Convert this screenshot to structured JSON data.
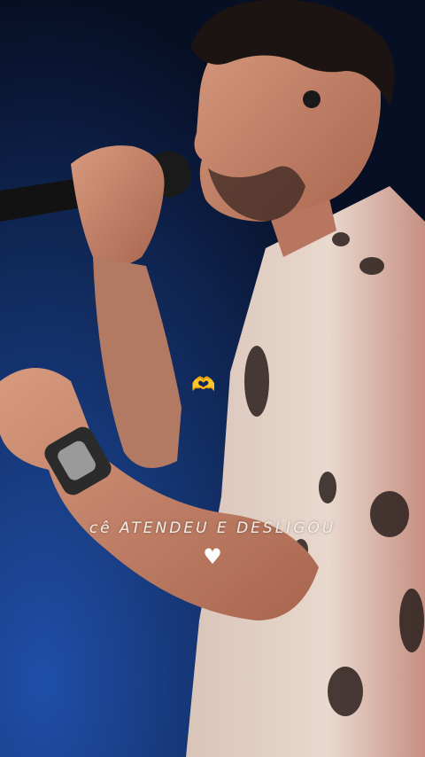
{
  "overlay": {
    "caption": "cê ATENDEU E DESLIGOU",
    "heart_hands_emoji": "🫶",
    "heart_symbol": "♥"
  },
  "colors": {
    "background": "#0a1630",
    "spotlight": "#1f4fa8",
    "shirt": "#e6d6cc",
    "skin": "#c9876d",
    "caption": "#f3ece6"
  }
}
